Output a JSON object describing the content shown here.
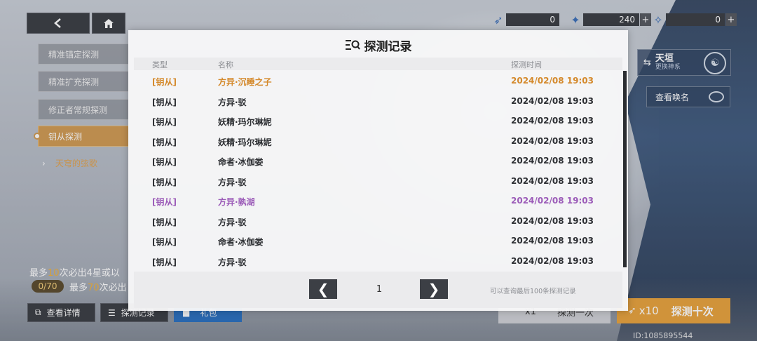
{
  "resources": [
    {
      "icon": "blue-feather-icon",
      "value": "0",
      "plus": ""
    },
    {
      "icon": "star-crystal-icon",
      "value": "240",
      "plus": "+"
    },
    {
      "icon": "blue-ticket-icon",
      "value": "0",
      "plus": "+"
    }
  ],
  "menu": {
    "items": [
      "精准锚定探测",
      "精准扩充探测",
      "修正者常规探测",
      "钥从探测"
    ],
    "active_index": 3,
    "sub_item": "天穹的弦歌"
  },
  "info": {
    "line1_prefix": "最多",
    "line1_hl": "10",
    "line1_suffix": "次必出4星或以",
    "counter": "0/70",
    "line2_prefix": "最多",
    "line2_hl": "70",
    "line2_suffix": "次必出"
  },
  "bottom_buttons": {
    "detail": "查看详情",
    "record": "探测记录",
    "pack": "礼包"
  },
  "right": {
    "card_title": "天垣",
    "card_sub": "更换神系",
    "view_name": "查看唤名",
    "draw1_x": "x1",
    "draw1_label": "探测一次",
    "draw10_x": "x10",
    "draw10_label": "探测十次",
    "uid": "ID:1085895544"
  },
  "modal": {
    "title": "探测记录",
    "headers": {
      "type": "类型",
      "name": "名称",
      "time": "探测时间"
    },
    "rows": [
      {
        "type": "[钥从]",
        "name": "方异·沉睡之子",
        "time": "2024/02/08 19:03",
        "rarity": "gold"
      },
      {
        "type": "[钥从]",
        "name": "方异·驳",
        "time": "2024/02/08 19:03",
        "rarity": "normal"
      },
      {
        "type": "[钥从]",
        "name": "妖精·玛尔琳妮",
        "time": "2024/02/08 19:03",
        "rarity": "normal"
      },
      {
        "type": "[钥从]",
        "name": "妖精·玛尔琳妮",
        "time": "2024/02/08 19:03",
        "rarity": "normal"
      },
      {
        "type": "[钥从]",
        "name": "命者·冰伽娄",
        "time": "2024/02/08 19:03",
        "rarity": "normal"
      },
      {
        "type": "[钥从]",
        "name": "方异·驳",
        "time": "2024/02/08 19:03",
        "rarity": "normal"
      },
      {
        "type": "[钥从]",
        "name": "方异·孰湖",
        "time": "2024/02/08 19:03",
        "rarity": "purple"
      },
      {
        "type": "[钥从]",
        "name": "方异·驳",
        "time": "2024/02/08 19:03",
        "rarity": "normal"
      },
      {
        "type": "[钥从]",
        "name": "命者·冰伽娄",
        "time": "2024/02/08 19:03",
        "rarity": "normal"
      },
      {
        "type": "[钥从]",
        "name": "方异·驳",
        "time": "2024/02/08 19:03",
        "rarity": "normal"
      }
    ],
    "page": "1",
    "prev": "❮",
    "next": "❯",
    "note": "可以查询最后100条探测记录"
  },
  "colors": {
    "gold": "#d4892b",
    "purple": "#9b5bb8",
    "accent": "#e7a23c"
  }
}
